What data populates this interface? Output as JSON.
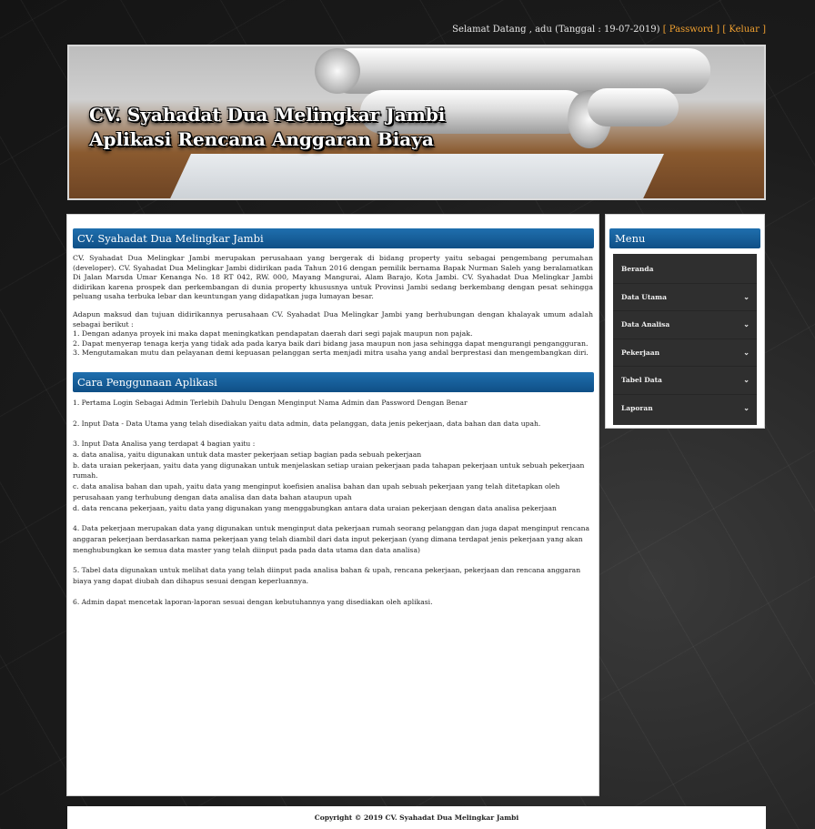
{
  "topbar": {
    "greeting": "Selamat Datang , adu (Tanggal : 19-07-2019)",
    "password_link": "[ Password ]",
    "logout_link": "[ Keluar ]"
  },
  "header": {
    "title_line1": "CV. Syahadat Dua Melingkar Jambi",
    "title_line2": "Aplikasi Rencana Anggaran Biaya"
  },
  "main": {
    "section1_title": "CV. Syahadat Dua Melingkar Jambi",
    "intro_p1": "CV. Syahadat Dua Melingkar Jambi merupakan perusahaan yang bergerak di bidang property yaitu sebagai pengembang perumahan (developer). CV. Syahadat Dua Melingkar Jambi didirikan pada Tahun 2016 dengan pemilik bernama Bapak Nurman Saleh yang beralamatkan Di Jalan Marsda Umar Kenanga No. 18 RT 042, RW. 000, Mayang Mangurai, Alam Barajo, Kota Jambi. CV. Syahadat Dua Melingkar Jambi didirikan karena prospek dan perkembangan di dunia property khususnya untuk Provinsi Jambi sedang berkembang dengan pesat sehingga peluang usaha terbuka lebar dan keuntungan yang didapatkan juga lumayan besar.",
    "intro_p2_lead": "Adapun maksud dan tujuan didirikannya perusahaan CV. Syahadat Dua Melingkar Jambi yang berhubungan dengan khalayak umum adalah sebagai berikut :",
    "intro_p2_1": "1. Dengan adanya proyek ini maka dapat meningkatkan pendapatan daerah dari segi pajak maupun non pajak.",
    "intro_p2_2": "2. Dapat menyerap tenaga kerja yang tidak ada pada karya baik dari bidang jasa maupun non jasa sehingga dapat mengurangi pengangguran.",
    "intro_p2_3": "3. Mengutamakan mutu dan pelayanan demi kepuasan pelanggan serta menjadi mitra usaha yang andal berprestasi dan mengembangkan diri.",
    "section2_title": "Cara Penggunaan Aplikasi",
    "usage_1": "1. Pertama Login Sebagai Admin Terlebih Dahulu Dengan Menginput Nama Admin dan Password Dengan Benar",
    "usage_2": "2. Input Data - Data Utama yang telah disediakan yaitu data admin, data pelanggan, data jenis pekerjaan, data bahan dan data upah.",
    "usage_3_lead": "3. Input Data Analisa yang terdapat 4 bagian yaitu :",
    "usage_3a": "a. data analisa, yaitu digunakan untuk data master pekerjaan setiap bagian pada sebuah pekerjaan",
    "usage_3b": "b. data uraian pekerjaan, yaitu data yang digunakan untuk menjelaskan setiap uraian pekerjaan pada tahapan pekerjaan untuk sebuah pekerjaan rumah.",
    "usage_3c": "c. data analisa bahan dan upah, yaitu data yang menginput koefisien analisa bahan dan upah sebuah pekerjaan yang telah ditetapkan oleh perusahaan yang terhubung dengan data analisa dan data bahan ataupun upah",
    "usage_3d": "d. data rencana pekerjaan, yaitu data yang digunakan yang menggabungkan antara data uraian pekerjaan dengan data analisa pekerjaan",
    "usage_4": "4. Data pekerjaan merupakan data yang digunakan untuk menginput data pekerjaan rumah seorang pelanggan dan juga dapat menginput rencana anggaran pekerjaan berdasarkan nama pekerjaan yang telah diambil dari data input pekerjaan (yang dimana terdapat jenis pekerjaan yang akan menghubungkan ke semua data master yang telah diinput pada pada data utama dan data analisa)",
    "usage_5": "5. Tabel data digunakan untuk melihat data yang telah diinput pada analisa bahan & upah, rencana pekerjaan, pekerjaan dan rencana anggaran biaya yang dapat diubah dan dihapus sesuai dengan keperluannya.",
    "usage_6": "6. Admin dapat mencetak laporan-laporan sesuai dengan kebutuhannya yang disediakan oleh aplikasi."
  },
  "sidebar": {
    "title": "Menu",
    "items": [
      {
        "label": "Beranda",
        "has_submenu": false
      },
      {
        "label": "Data Utama",
        "has_submenu": true
      },
      {
        "label": "Data Analisa",
        "has_submenu": true
      },
      {
        "label": "Pekerjaan",
        "has_submenu": true
      },
      {
        "label": "Tabel Data",
        "has_submenu": true
      },
      {
        "label": "Laporan",
        "has_submenu": true
      }
    ]
  },
  "footer": {
    "copyright": "Copyright © 2019 CV. Syahadat Dua Melingkar Jambi"
  },
  "colors": {
    "accent_blue": "#125a95",
    "link_orange": "#f0a030",
    "menu_bg": "#2f2f2f"
  }
}
